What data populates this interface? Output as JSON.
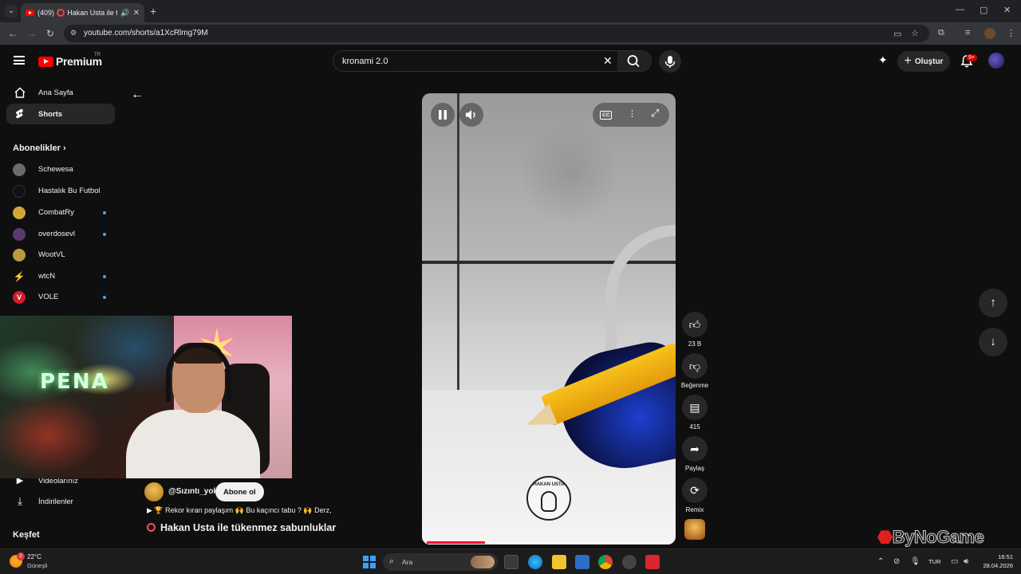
{
  "browser": {
    "tab_title": "(409) ⭕ Hakan Usta ile tük",
    "url": "youtube.com/shorts/a1XcRlmg79M",
    "newtab_glyph": "+",
    "window_controls": [
      "—",
      "▢",
      "✕"
    ]
  },
  "header": {
    "brand": "Premium",
    "region": "TR",
    "search_query": "kronami 2.0",
    "create_label": "Oluştur",
    "notifications_count": "9+"
  },
  "sidebar": {
    "items": [
      {
        "label": "Ana Sayfa",
        "icon": "home-icon"
      },
      {
        "label": "Shorts",
        "icon": "shorts-icon",
        "active": true
      }
    ],
    "subscriptions_heading": "Abonelikler",
    "channels": [
      {
        "name": "Schewesa",
        "color": "#6b6b6b",
        "new": false
      },
      {
        "name": "Hastalık Bu Futbol",
        "color": "#111111",
        "new": false
      },
      {
        "name": "CombatRy",
        "color": "#d4a53a",
        "new": true
      },
      {
        "name": "overdosevl",
        "color": "#5a3b6b",
        "new": true
      },
      {
        "name": "WootVL",
        "color": "#b99a40",
        "new": false
      },
      {
        "name": "wtcN",
        "color": "#e6c43a",
        "new": true
      },
      {
        "name": "VOLE",
        "color": "#d01c2a",
        "new": true
      }
    ],
    "lower_items": [
      {
        "label": "Videolarınız",
        "icon": "video-icon"
      },
      {
        "label": "İndirilenler",
        "icon": "download-icon"
      }
    ],
    "explore_heading": "Keşfet"
  },
  "webcam": {
    "logo_text": "PENA"
  },
  "short": {
    "channel_handle": "@Sızıntı_yok",
    "subscribe_label": "Abone ol",
    "description": "▶ 🏆 Rekor kıran paylaşım 🙌 Bu kaçıncı tabu ? 🙌  Derz,",
    "title": "Hakan Usta ile tükenmez sabunluklar",
    "watermark_text": "HAKAN USTA",
    "progress": 0.24
  },
  "actions": {
    "like_count": "23 B",
    "dislike_label": "Beğenme",
    "comment_count": "415",
    "share_label": "Paylaş",
    "remix_label": "Remix"
  },
  "overlay": {
    "brand_watermark": "ByNoGame"
  },
  "taskbar": {
    "weather_badge": "2",
    "temperature": "22°C",
    "weather_desc": "Güneşli",
    "search_placeholder": "Ara",
    "language": "TUR",
    "time": "16:51",
    "date": "28.04.2026"
  }
}
